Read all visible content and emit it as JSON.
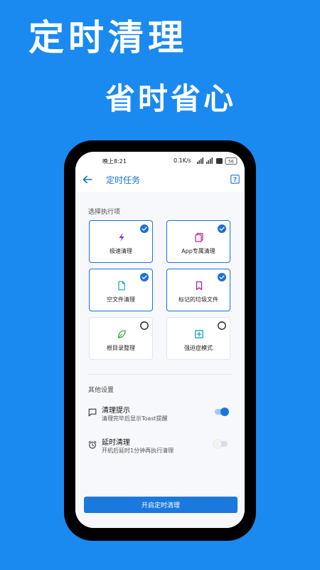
{
  "promo": {
    "title": "定时清理",
    "subtitle": "省时省心"
  },
  "status_bar": {
    "time": "晚上8:21",
    "network_speed": "0.1K/s",
    "battery": "56"
  },
  "header": {
    "title": "定时任务"
  },
  "sections": {
    "execution_label": "选择执行项",
    "other_label": "其他设置"
  },
  "options": [
    {
      "label": "极速清理",
      "selected": true,
      "icon": "lightning-icon",
      "color": "#8a2be2"
    },
    {
      "label": "App专属清理",
      "selected": true,
      "icon": "app-pages-icon",
      "color": "#c0268d"
    },
    {
      "label": "空文件清理",
      "selected": true,
      "icon": "file-icon",
      "color": "#1aa6b8"
    },
    {
      "label": "标记的垃圾文件",
      "selected": true,
      "icon": "bookmark-icon",
      "color": "#b3209d"
    },
    {
      "label": "根目录整理",
      "selected": false,
      "icon": "leaf-icon",
      "color": "#41a749"
    },
    {
      "label": "强迫症模式",
      "selected": false,
      "icon": "plus-square-icon",
      "color": "#17a4b3"
    }
  ],
  "settings": [
    {
      "title": "清理提示",
      "description": "清理完毕后显示Toast提醒",
      "enabled": true,
      "icon": "message-icon"
    },
    {
      "title": "延时清理",
      "description": "开机后延时1分钟再执行清理",
      "enabled": false,
      "icon": "alarm-clock-icon"
    }
  ],
  "button": {
    "label": "开启定时清理"
  },
  "colors": {
    "background": "#1a8af1",
    "accent": "#1a79dd",
    "header_text": "#1572d6"
  }
}
